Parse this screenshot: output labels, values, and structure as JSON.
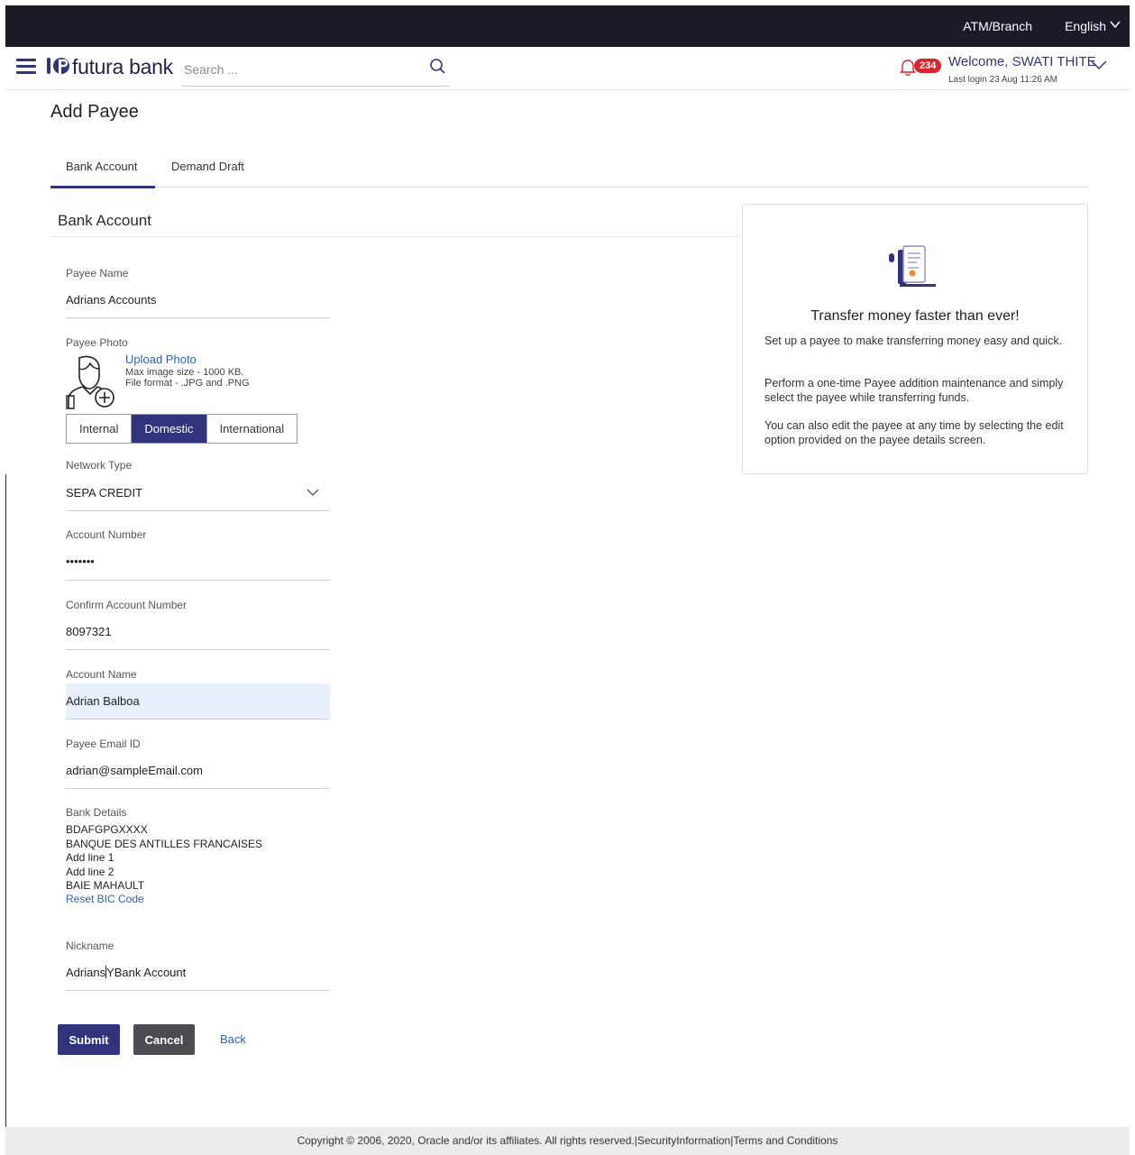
{
  "topbar": {
    "atm_branch": "ATM/Branch",
    "language": "English"
  },
  "header": {
    "brand": "futura bank",
    "search_placeholder": "Search ...",
    "notification_count": "234",
    "welcome": "Welcome, SWATI THITE",
    "last_login": "Last login 23 Aug 11:26 AM"
  },
  "page": {
    "title": "Add Payee",
    "tabs": [
      {
        "label": "Bank Account",
        "active": true
      },
      {
        "label": "Demand Draft",
        "active": false
      }
    ],
    "section_title": "Bank Account"
  },
  "form": {
    "payee_name_label": "Payee Name",
    "payee_name_value": "Adrians Accounts",
    "payee_photo_label": "Payee Photo",
    "upload_photo": "Upload Photo",
    "max_image_size": "Max image size - 1000 KB.",
    "file_format": "File format - .JPG and .PNG",
    "payee_types": [
      "Internal",
      "Domestic",
      "International"
    ],
    "payee_type_selected": "Domestic",
    "network_type_label": "Network Type",
    "network_type_value": "SEPA CREDIT",
    "account_number_label": "Account Number",
    "account_number_value": "•••••••",
    "confirm_account_label": "Confirm Account Number",
    "confirm_account_value": "8097321",
    "account_name_label": "Account Name",
    "account_name_value": "Adrian Balboa",
    "email_label": "Payee Email ID",
    "email_value": "adrian@sampleEmail.com",
    "bank_details_label": "Bank Details",
    "bank_details_lines": [
      "BDAFGPGXXXX",
      "BANQUE DES ANTILLES FRANCAISES",
      "Add line 1",
      "Add line 2",
      "BAIE MAHAULT"
    ],
    "reset_bic": "Reset BIC Code",
    "nickname_label": "Nickname",
    "nickname_before_cursor": "Adrians",
    "nickname_after_cursor": "YBank Account"
  },
  "actions": {
    "submit": "Submit",
    "cancel": "Cancel",
    "back": "Back"
  },
  "info_card": {
    "title": "Transfer money faster than ever!",
    "p1": "Set up a payee to make transferring money easy and quick.",
    "p2": "Perform a one-time Payee addition maintenance and simply select the payee while transferring funds.",
    "p3": "You can also edit the payee at any time by selecting the edit option provided on the payee details screen."
  },
  "footer": {
    "text": "Copyright © 2006, 2020, Oracle and/or its affiliates. All rights reserved.|SecurityInformation|Terms and Conditions"
  },
  "colors": {
    "primary": "#31347a",
    "link": "#2f61b5",
    "badge": "#d7262e",
    "topbar": "#1b1b28"
  }
}
